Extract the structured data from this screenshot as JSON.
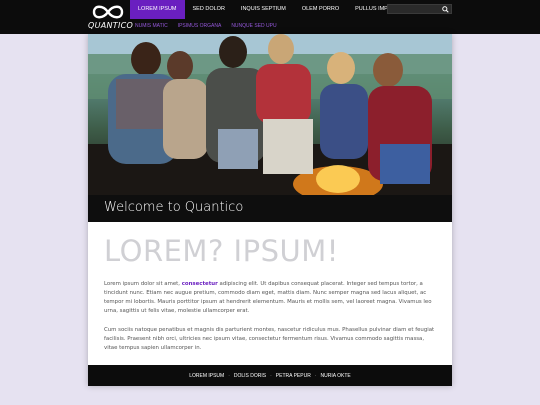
{
  "brand": {
    "name": "QUANTICO"
  },
  "nav": {
    "items": [
      {
        "label": "LOREM IPSUM",
        "active": true
      },
      {
        "label": "SED DOLOR",
        "active": false
      },
      {
        "label": "INQUIS SEPTIUM",
        "active": false
      },
      {
        "label": "OLEM PORRO",
        "active": false
      },
      {
        "label": "PULLUS IMPOUS",
        "active": false
      }
    ],
    "subnav": [
      "NUMIS MATIC",
      "IPSIMUS ORGANA",
      "NUNQUE SED UPU"
    ]
  },
  "search": {
    "placeholder": ""
  },
  "hero": {
    "alt": "group photo"
  },
  "welcome": "Welcome to Quantico",
  "headline": "LOREM? IPSUM!",
  "body": {
    "p1_before": "Lorem ipsum dolor sit amet, ",
    "p1_link": "consectetur",
    "p1_after": " adipiscing elit. Ut dapibus consequat placerat. Integer sed tempus tortor, a tincidunt nunc. Etiam nec augue pretium, commodo diam eget, mattis diam. Nunc semper magna sed lacus aliquet, ac tempor mi lobortis. Mauris porttitor ipsum at hendrerit elementum. Mauris et mollis sem, vel laoreet magna. Vivamus leo urna, sagittis ut felis vitae, molestie ullamcorper erat.",
    "p2": "Cum sociis natoque penatibus et magnis dis parturient montes, nascetur ridiculus mus. Phasellus pulvinar diam et feugiat facilisis. Praesent nibh orci, ultricies nec ipsum vitae, consectetur fermentum risus. Vivamus commodo sagittis massa, vitae tempus sapien ullamcorper in."
  },
  "footer": {
    "items": [
      "LOREM IPSUM",
      "DOLIS DORIS",
      "PETRA PEPUR",
      "NURIA OKTE"
    ]
  },
  "colors": {
    "accent": "#6a1fc0",
    "bar": "#0c0c0c",
    "background": "#e6e2f1"
  }
}
